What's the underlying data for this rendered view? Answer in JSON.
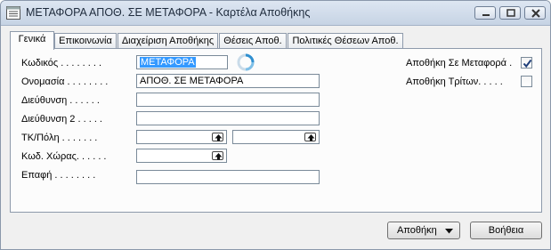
{
  "window": {
    "title": "ΜΕΤΑΦΟΡΑ ΑΠΟΘ. ΣΕ ΜΕΤΑΦΟΡΑ - Καρτέλα Αποθήκης"
  },
  "tabs": [
    {
      "label": "Γενικά",
      "active": true
    },
    {
      "label": "Επικοινωνία",
      "active": false
    },
    {
      "label": "Διαχείριση Αποθήκης",
      "active": false
    },
    {
      "label": "Θέσεις Αποθ.",
      "active": false
    },
    {
      "label": "Πολιτικές Θέσεων Αποθ.",
      "active": false
    }
  ],
  "form": {
    "code_label": "Κωδικός . . . . . . . .",
    "code_value": "ΜΕΤΑΦΟΡΑ",
    "name_label": "Ονομασία . . . . . . . .",
    "name_value": "ΑΠΟΘ. ΣΕ ΜΕΤΑΦΟΡΑ",
    "address_label": "Διεύθυνση . . . . . .",
    "address_value": "",
    "address2_label": "Διεύθυνση 2 . . . . .",
    "address2_value": "",
    "postcode_city_label": "ΤΚ/Πόλη . . . . . . .",
    "postcode_value": "",
    "city_value": "",
    "country_label": "Κωδ. Χώρας. . . . . .",
    "country_value": "",
    "contact_label": "Επαφή . . . . . . . .",
    "contact_value": "",
    "in_transit_label": "Αποθήκη Σε Μεταφορά .",
    "in_transit_checked": true,
    "third_party_label": "Αποθήκη Τρίτων. . . . .",
    "third_party_checked": false
  },
  "buttons": {
    "warehouse_label": "Αποθήκη",
    "help_label": "Βοήθεια"
  },
  "colors": {
    "selection": "#3399ff",
    "titlebar": "#c6d3e4",
    "check": "#1f3f7a"
  }
}
